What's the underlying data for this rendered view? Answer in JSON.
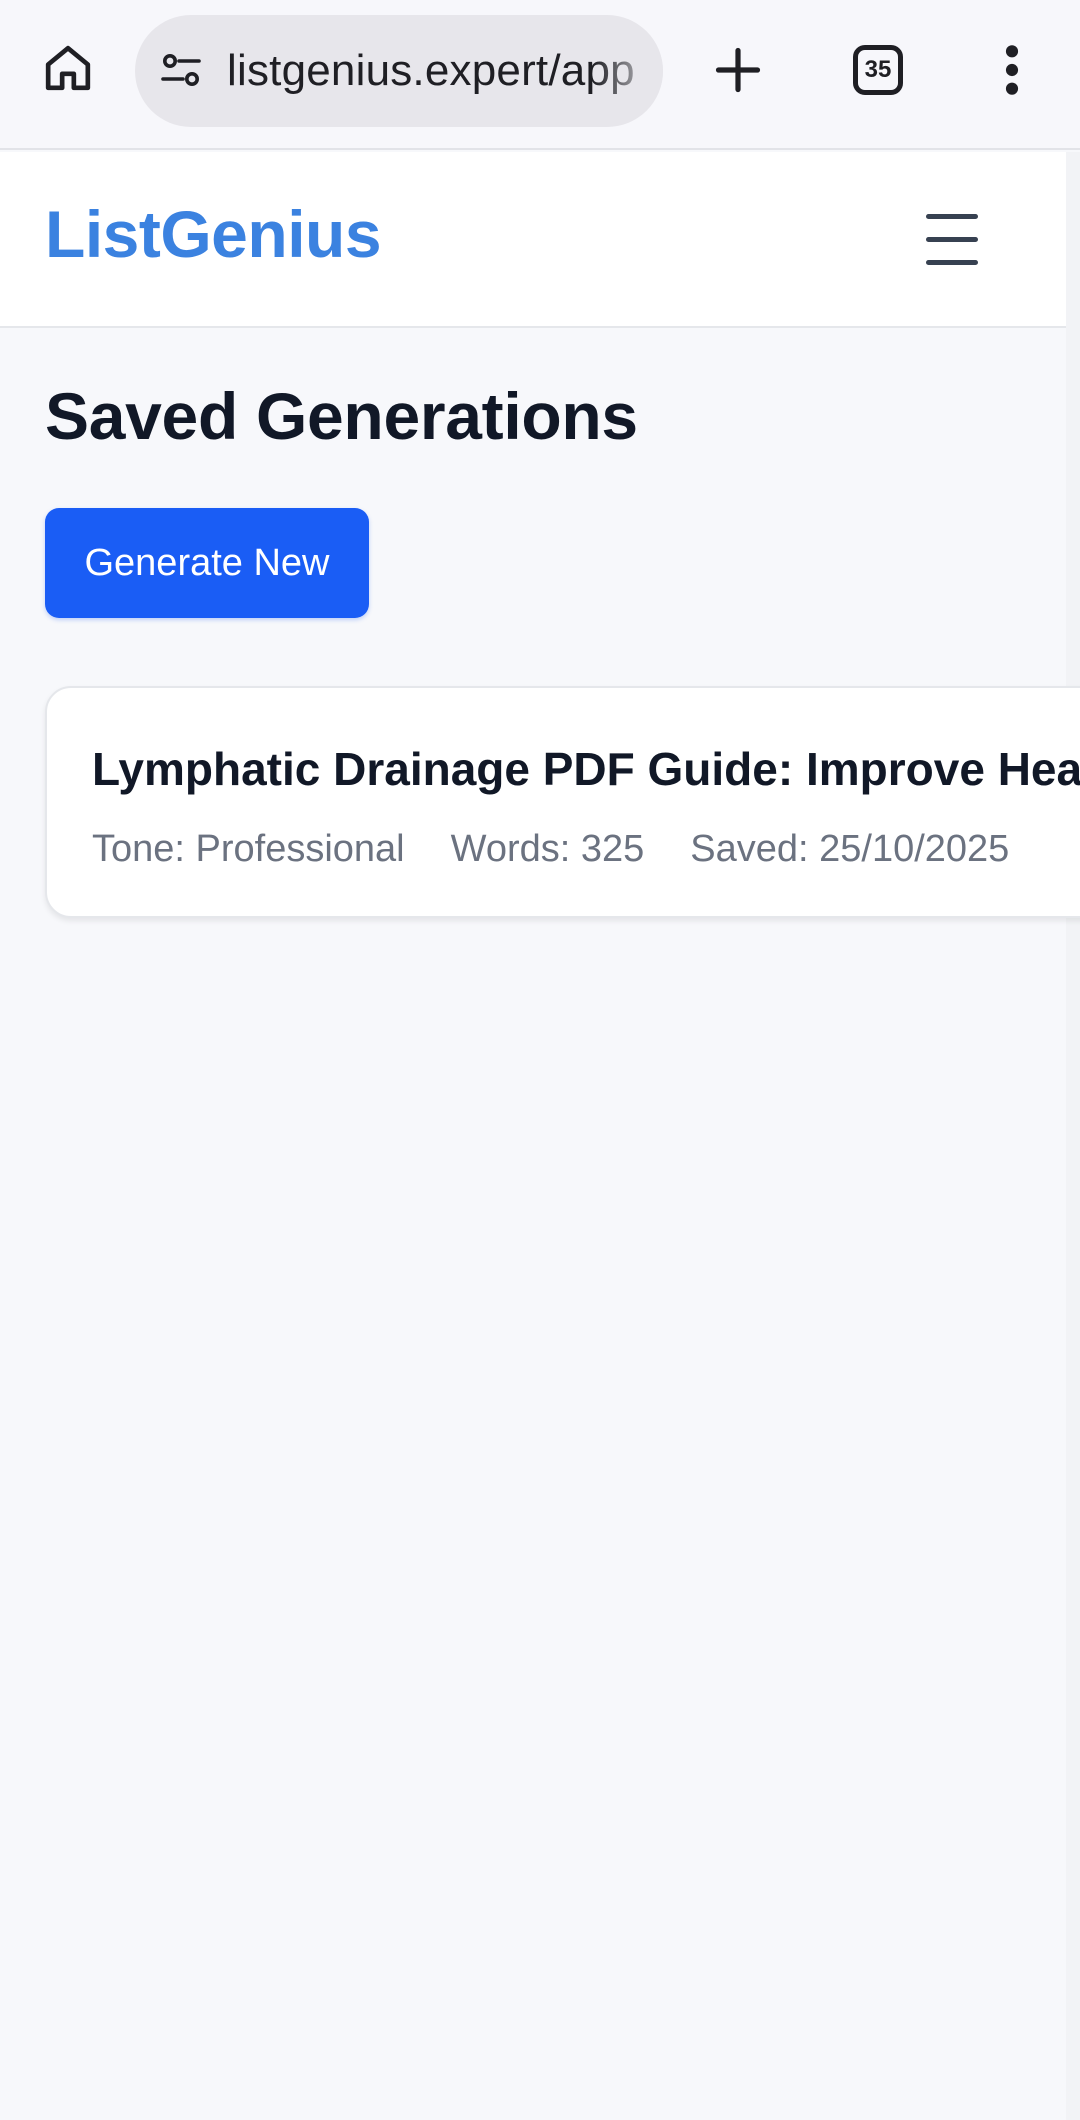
{
  "browser": {
    "url": "listgenius.expert/app",
    "tab_count": "35",
    "icons": {
      "home": "home-icon",
      "site_info": "site-info-icon",
      "new_tab": "plus-icon",
      "tabs": "tab-switcher-icon",
      "menu": "kebab-menu-icon"
    }
  },
  "header": {
    "brand": "ListGenius",
    "menu_icon": "hamburger-icon"
  },
  "main": {
    "title": "Saved Generations",
    "generate_button": "Generate New",
    "generations": [
      {
        "title": "Lymphatic Drainage PDF Guide: Improve Health",
        "tone": "Tone: Professional",
        "words": "Words: 325",
        "saved": "Saved: 25/10/2025"
      }
    ]
  },
  "colors": {
    "brand": "#3b82e0",
    "primary_button": "#1a5df5",
    "title_text": "#111827",
    "meta_text": "#6b7280",
    "page_background": "#f7f8fb"
  }
}
